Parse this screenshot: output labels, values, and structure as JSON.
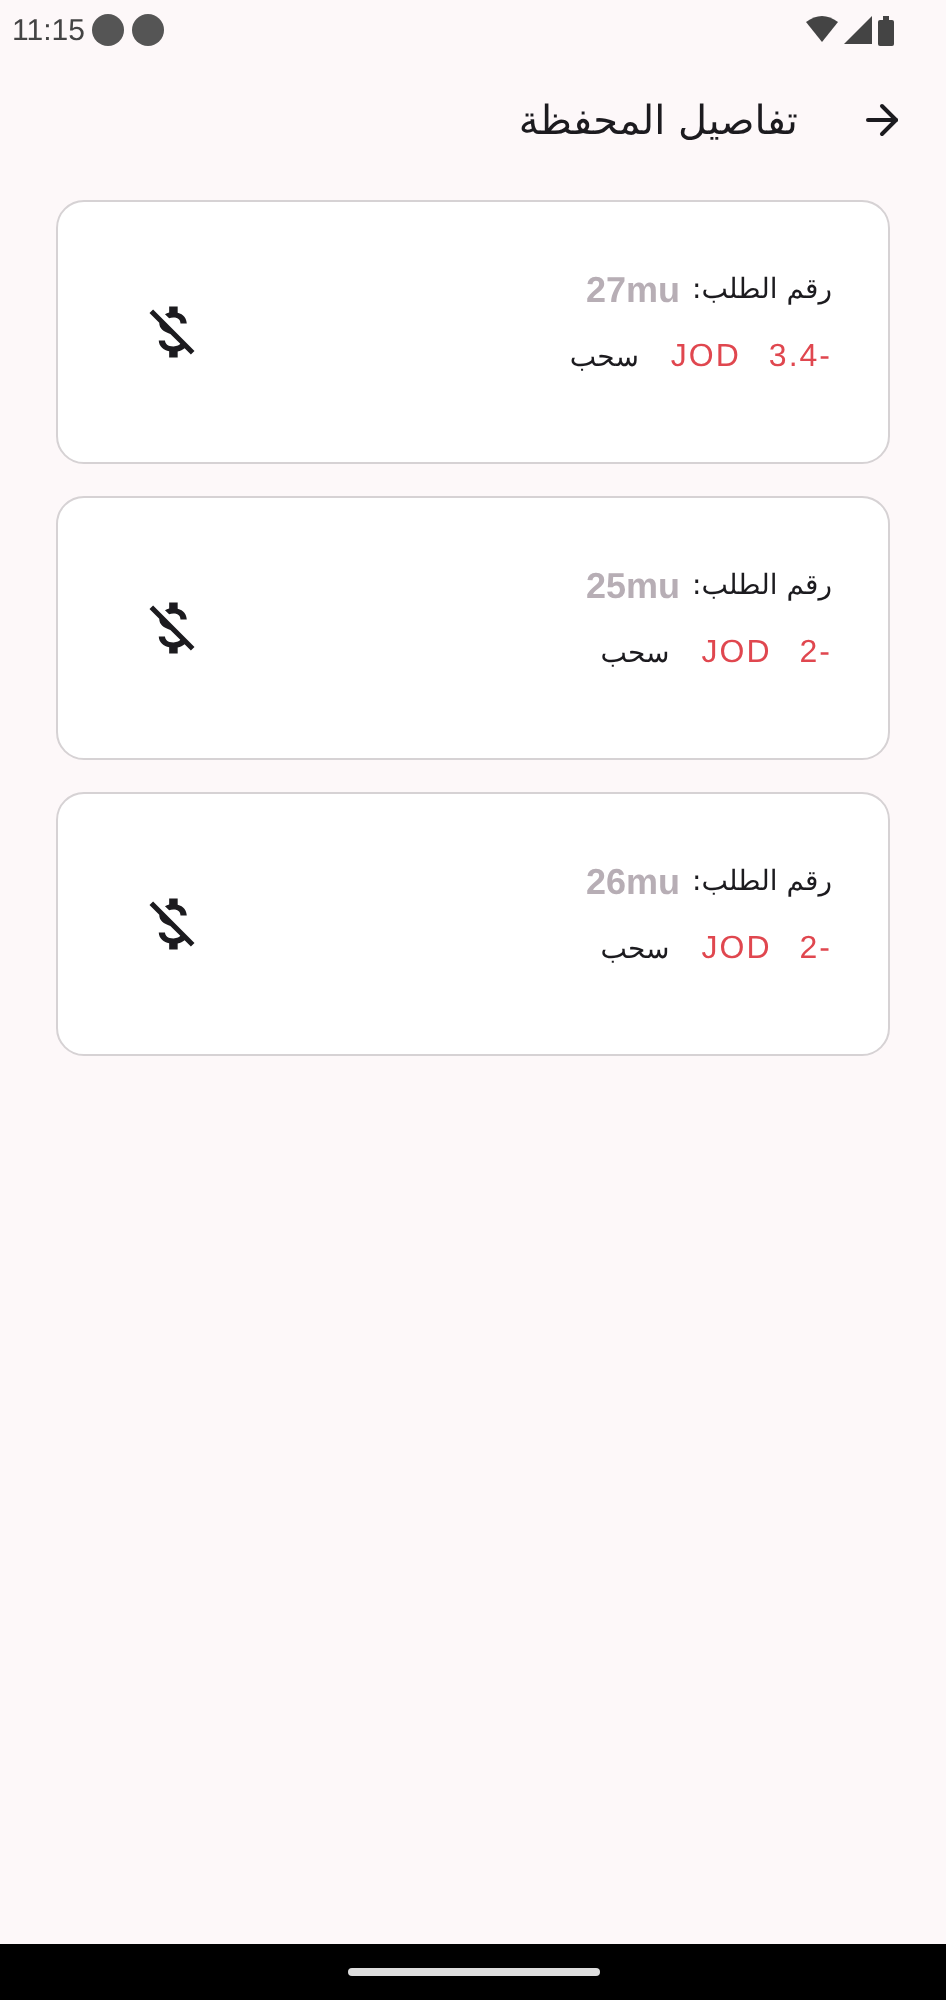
{
  "status_bar": {
    "time": "11:15"
  },
  "header": {
    "title": "تفاصيل المحفظة"
  },
  "transactions": [
    {
      "order_label": "رقم الطلب:",
      "order_id": "27mu",
      "amount": "3.4-",
      "currency": "JOD",
      "type_label": "سحب"
    },
    {
      "order_label": "رقم الطلب:",
      "order_id": "25mu",
      "amount": "2-",
      "currency": "JOD",
      "type_label": "سحب"
    },
    {
      "order_label": "رقم الطلب:",
      "order_id": "26mu",
      "amount": "2-",
      "currency": "JOD",
      "type_label": "سحب"
    }
  ]
}
